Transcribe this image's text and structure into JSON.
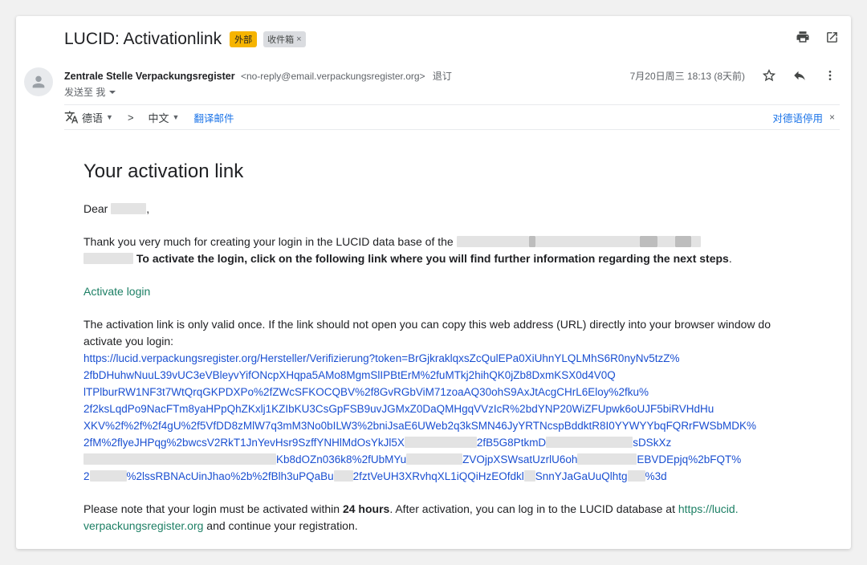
{
  "header": {
    "subject": "LUCID: Activationlink",
    "label_external": "外部",
    "label_inbox": "收件箱",
    "label_inbox_remove": "×"
  },
  "sender": {
    "name": "Zentrale Stelle Verpackungsregister",
    "email": "<no-reply@email.verpackungsregister.org>",
    "unsubscribe": "退订",
    "recipient": "发送至 我",
    "date": "7月20日周三 18:13 (8天前)"
  },
  "translate": {
    "source_lang": "德语",
    "arrow": ">",
    "target_lang": "中文",
    "translate_link": "翻译邮件",
    "disable": "对德语停用",
    "close": "×"
  },
  "body": {
    "title": "Your activation link",
    "greeting_prefix": "Dear ",
    "greeting_suffix": ",",
    "intro_text": "Thank you very much for creating your login in the LUCID data base of the",
    "intro_bold": "To activate the login, click on the following link where you will find further information regarding the next steps",
    "intro_end": ".",
    "activate_link": "Activate login",
    "valid_once": "The activation link is only valid once. If the link should not open you can copy this web address (URL) directly into your browser window do activate you login:",
    "url_lines": [
      "https://lucid.verpackungsregister.org/Hersteller/Verifizierung?token=BrGjkraklqxsZcQulEPa0XiUhnYLQLMhS6R0nyNv5tzZ%",
      "2fbDHuhwNuuL39vUC3eVBleyvYifONcpXHqpa5AMo8MgmSlIPBtErM%2fuMTkj2hihQK0jZb8DxmKSX0d4V0Q",
      "lTPlburRW1NF3t7WtQrqGKPDXPo%2fZWcSFKOCQBV%2f8GvRGbViM71zoaAQ30ohS9AxJtAcgCHrL6Eloy%2fku%",
      "2f2ksLqdPo9NacFTm8yaHPpQhZKxlj1KZIbKU3CsGpFSB9uvJGMxZ0DaQMHgqVVzIcR%2bdYNP20WiZFUpwk6oUJF5biRVHdHu",
      "XKV%2f%2f%2f4gU%2f5VfDD8zMlW7q3mM3No0bILW3%2bniJsaE6UWeb2q3kSMN46JyYRTNcspBddktR8I0YYWYYbqFQRrFWSbMDK%",
      "2fM%2flyeJHPqg%2bwcsV2RkT1JnYevHsr9SzffYNHlMdOsYkJl5X"
    ],
    "url_line6_end": "2fB5G8PtkmD",
    "url_line6_tail": "sDSkXz",
    "url_line7_mid": "Kb8dOZn036k8%2fUbMYu",
    "url_line7_mid2": "ZVOjpXSWsatUzrlU6oh",
    "url_line7_end": "EBVDEpjq%2bFQT%",
    "url_line8_start": "2",
    "url_line8_mid": "%2lssRBNAcUinJhao%2b%2fBlh3uPQaBu",
    "url_line8_mid2": "2fztVeUH3XRvhqXL1iQQiHzEOfdkl",
    "url_line8_mid3": "SnnYJaGaUuQlhtg",
    "url_line8_end": "%3d",
    "note_prefix": "Please note that your login must be activated within ",
    "note_bold": "24 hours",
    "note_middle": ". After activation, you can log in to the LUCID database at ",
    "note_link_1": "https://lucid.",
    "note_link_2": "verpackungsregister.org",
    "note_suffix": " and continue your registration."
  },
  "colors": {
    "badge_external": "#f6b400",
    "link_green": "#1c7f64",
    "link_blue": "#1a4fd1",
    "accent_blue": "#1a73e8"
  },
  "icons": [
    "print-icon",
    "open-in-new-window-icon",
    "avatar-person-icon",
    "star-icon",
    "reply-icon",
    "more-vert-icon",
    "translate-icon",
    "chevron-down-icon"
  ]
}
